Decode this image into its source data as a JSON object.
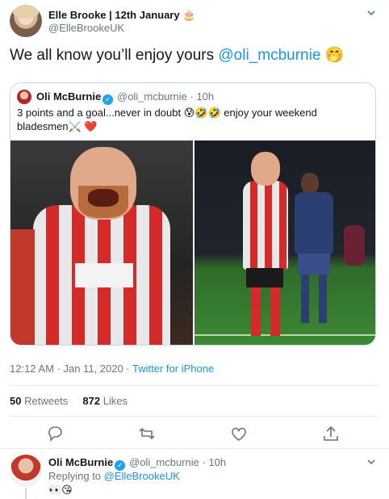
{
  "tweet": {
    "author_name": "Elle Brooke | 12th January 🎂",
    "author_handle": "@ElleBrookeUK",
    "text_before": "We all know you’ll enjoy yours ",
    "mention": "@oli_mcburnie",
    "emoji": "🤭",
    "time": "12:12 AM · Jan 11, 2020 · ",
    "source": "Twitter for iPhone",
    "retweets_count": "50",
    "retweets_label": "Retweets",
    "likes_count": "872",
    "likes_label": "Likes"
  },
  "quoted": {
    "author_name": "Oli McBurnie",
    "verified_mark": "✓",
    "meta": "@oli_mcburnie · 10h",
    "text": "3 points and a goal...never in doubt 😰🤣🤣 enjoy your weekend bladesmen⚔️ ❤️"
  },
  "reply": {
    "author_name": "Oli McBurnie",
    "verified_mark": "✓",
    "meta": "@oli_mcburnie · 10h",
    "replying_prefix": "Replying to ",
    "replying_to": "@ElleBrookeUK",
    "text": "👀😘"
  },
  "icons": {
    "caret": "chevron-down-icon",
    "reply": "reply-icon",
    "retweet": "retweet-icon",
    "like": "heart-icon",
    "share": "share-icon"
  },
  "colors": {
    "link": "#1b95e0",
    "muted": "#657786",
    "border": "#ccd6dd"
  }
}
